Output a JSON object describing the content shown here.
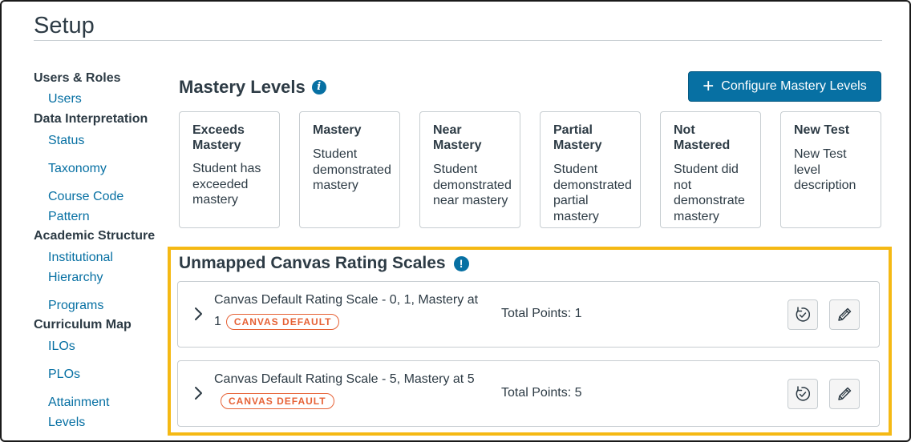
{
  "page": {
    "title": "Setup"
  },
  "sidebar": {
    "sections": [
      {
        "heading": "Users & Roles",
        "links": [
          "Users"
        ]
      },
      {
        "heading": "Data Interpretation",
        "links": [
          "Status",
          "Taxonomy",
          "Course Code Pattern"
        ]
      },
      {
        "heading": "Academic Structure",
        "links": [
          "Institutional Hierarchy",
          "Programs"
        ]
      },
      {
        "heading": "Curriculum Map",
        "links": [
          "ILOs",
          "PLOs",
          "Attainment Levels"
        ]
      }
    ]
  },
  "mastery": {
    "title": "Mastery Levels",
    "info_icon": "info-icon",
    "configure_label": "Configure Mastery Levels",
    "levels": [
      {
        "name": "Exceeds Mastery",
        "description": "Student has exceeded mastery"
      },
      {
        "name": "Mastery",
        "description": "Student demonstrated mastery"
      },
      {
        "name": "Near Mastery",
        "description": "Student demonstrated near mastery"
      },
      {
        "name": "Partial Mastery",
        "description": "Student demonstrated partial mastery"
      },
      {
        "name": "Not Mastered",
        "description": "Student did not demonstrate mastery"
      },
      {
        "name": "New Test",
        "description": "New Test level description"
      }
    ]
  },
  "unmapped": {
    "title": "Unmapped Canvas Rating Scales",
    "alert_icon": "alert-icon",
    "highlight_color": "#f5b914",
    "scales": [
      {
        "name": "Canvas Default Rating Scale - 0, 1, Mastery at 1",
        "badge": "CANVAS DEFAULT",
        "total_points": "Total Points: 1"
      },
      {
        "name": "Canvas Default Rating Scale - 5, Mastery at 5",
        "badge": "CANVAS DEFAULT",
        "total_points": "Total Points: 5"
      }
    ]
  },
  "colors": {
    "accent": "#0770a3",
    "badge": "#e66135",
    "text": "#2d3b45",
    "border": "#c7cdd1"
  }
}
